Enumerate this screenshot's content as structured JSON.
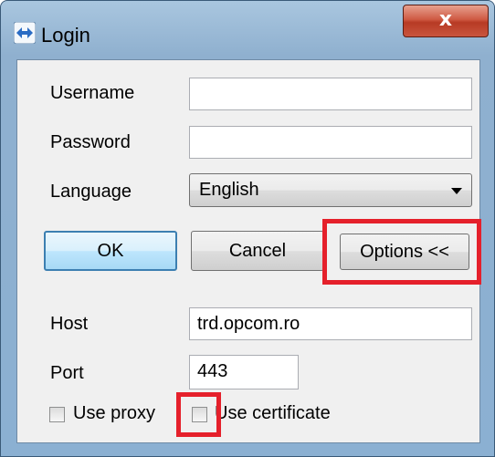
{
  "window": {
    "title": "Login",
    "close_label": "x"
  },
  "form": {
    "username_label": "Username",
    "username_value": "",
    "password_label": "Password",
    "password_value": "",
    "language_label": "Language",
    "language_value": "English"
  },
  "buttons": {
    "ok": "OK",
    "cancel": "Cancel",
    "options": "Options <<"
  },
  "options": {
    "host_label": "Host",
    "host_value": "trd.opcom.ro",
    "port_label": "Port",
    "port_value": "443",
    "use_proxy_label": "Use proxy",
    "use_proxy_checked": false,
    "use_certificate_label": "Use certificate",
    "use_certificate_checked": false
  },
  "colors": {
    "highlight": "#e5202b",
    "title_bar": "#a9c6df",
    "close_button": "#c9553e"
  }
}
